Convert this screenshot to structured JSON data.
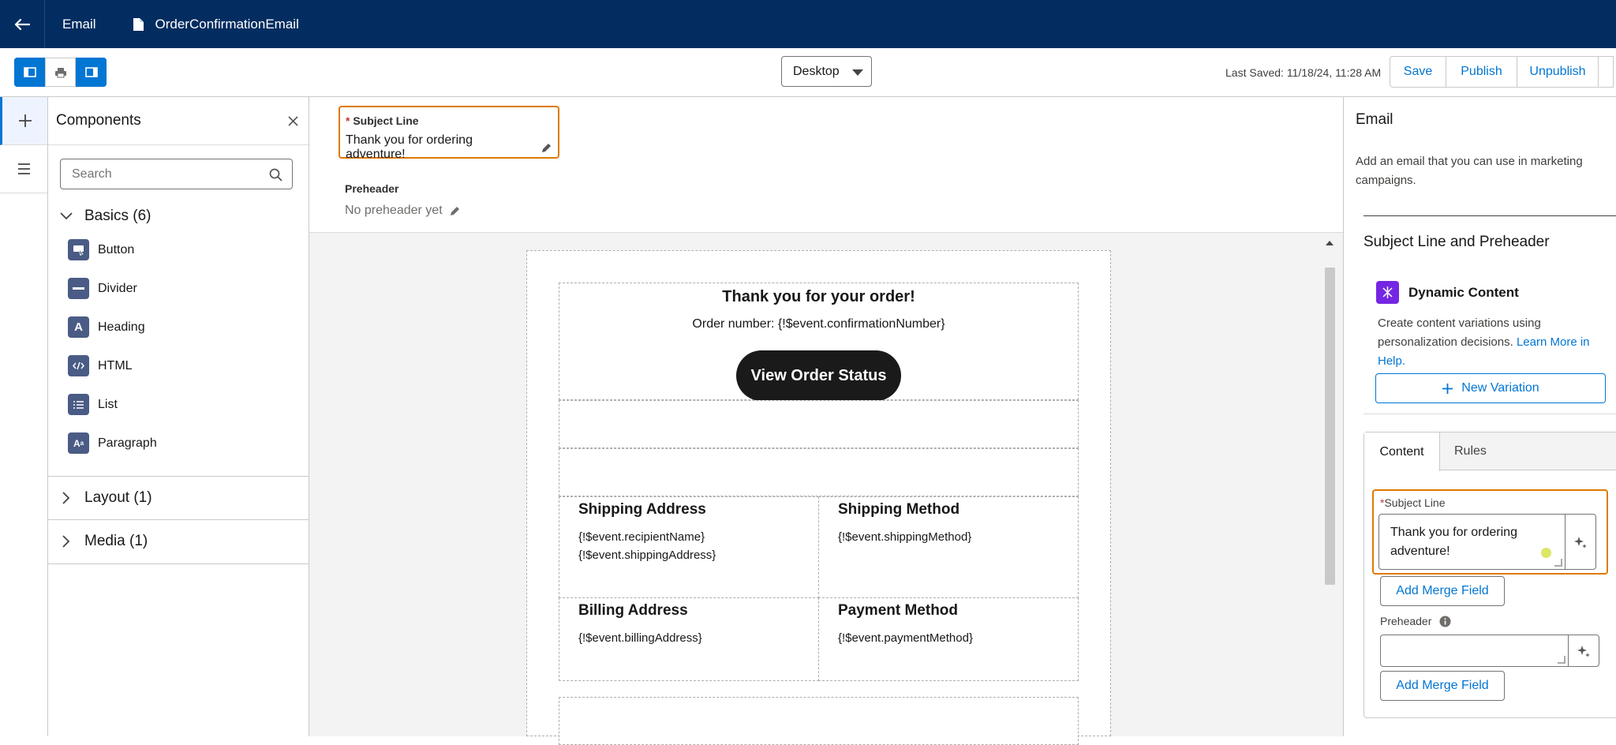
{
  "header": {
    "section": "Email",
    "document_name": "OrderConfirmationEmail"
  },
  "toolbar": {
    "device_select": "Desktop",
    "last_saved": "Last Saved: 11/18/24, 11:28 AM",
    "buttons": {
      "save": "Save",
      "publish": "Publish",
      "unpublish": "Unpublish"
    }
  },
  "components_panel": {
    "title": "Components",
    "search_placeholder": "Search",
    "sections": [
      {
        "label": "Basics (6)",
        "expanded": true
      },
      {
        "label": "Layout (1)",
        "expanded": false
      },
      {
        "label": "Media (1)",
        "expanded": false
      }
    ],
    "basics": [
      "Button",
      "Divider",
      "Heading",
      "HTML",
      "List",
      "Paragraph"
    ]
  },
  "editor": {
    "subject_label": "Subject Line",
    "subject_value": "Thank you for ordering adventure!",
    "preheader_label": "Preheader",
    "preheader_value": "No preheader yet"
  },
  "email": {
    "heading": "Thank you for your order!",
    "order_number": "Order number: {!$event.confirmationNumber}",
    "cta": "View Order Status",
    "shipping_address_title": "Shipping Address",
    "recipient_name": "{!$event.recipientName}",
    "shipping_address": "{!$event.shippingAddress}",
    "shipping_method_title": "Shipping Method",
    "shipping_method": "{!$event.shippingMethod}",
    "billing_address_title": "Billing Address",
    "billing_address": "{!$event.billingAddress}",
    "payment_method_title": "Payment Method",
    "payment_method": "{!$event.paymentMethod}"
  },
  "properties_panel": {
    "title": "Email",
    "description": "Add an email that you can use in marketing campaigns.",
    "section_heading": "Subject Line and Preheader",
    "dynamic_title": "Dynamic Content",
    "dynamic_desc": "Create content variations using personalization decisions.",
    "learn_more": "Learn More in Help.",
    "new_variation": "New Variation",
    "tabs": [
      "Content",
      "Rules"
    ],
    "subject_label": "Subject Line",
    "subject_value": "Thank you for ordering adventure!",
    "merge_field": "Add Merge Field",
    "preheader_label": "Preheader"
  },
  "colors": {
    "header_bg": "#032d60",
    "brand_blue": "#0176d3",
    "highlight_orange": "#dd7a01",
    "dynamic_purple": "#7526e3"
  }
}
